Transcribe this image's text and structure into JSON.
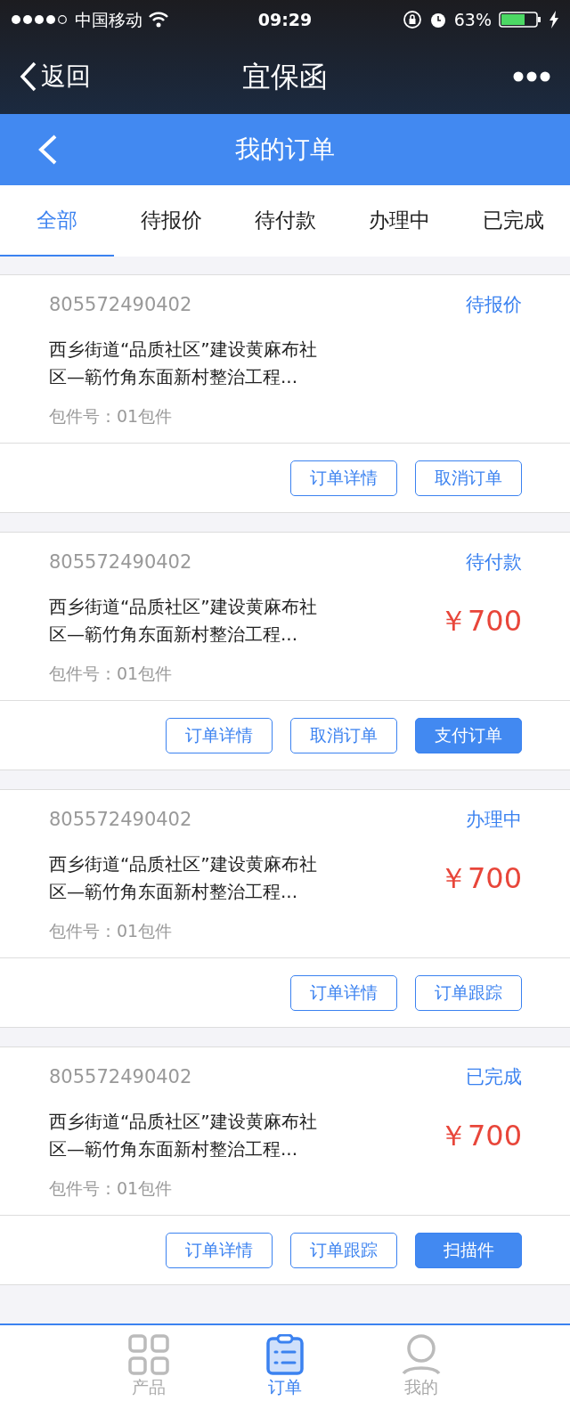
{
  "status_bar": {
    "carrier": "中国移动",
    "time": "09:29",
    "battery": "63%"
  },
  "nav_bar": {
    "back": "返回",
    "title": "宜保函"
  },
  "header": {
    "title": "我的订单"
  },
  "tabs": [
    {
      "label": "全部",
      "selected": true
    },
    {
      "label": "待报价",
      "selected": false
    },
    {
      "label": "待付款",
      "selected": false
    },
    {
      "label": "办理中",
      "selected": false
    },
    {
      "label": "已完成",
      "selected": false
    }
  ],
  "orders": [
    {
      "number": "805572490402",
      "status": "待报价",
      "title_lines": [
        "西乡街道“品质社区”建设黄麻布社",
        "区—簕竹角东面新村整治工程..."
      ],
      "package": "包件号：01包件",
      "buttons": [
        {
          "label": "订单详情",
          "primary": false
        },
        {
          "label": "取消订单",
          "primary": false
        }
      ]
    },
    {
      "number": "805572490402",
      "status": "待付款",
      "title_lines": [
        "西乡街道“品质社区”建设黄麻布社",
        "区—簕竹角东面新村整治工程..."
      ],
      "price": "￥700",
      "package": "包件号：01包件",
      "buttons": [
        {
          "label": "订单详情",
          "primary": false
        },
        {
          "label": "取消订单",
          "primary": false
        },
        {
          "label": "支付订单",
          "primary": true
        }
      ]
    },
    {
      "number": "805572490402",
      "status": "办理中",
      "title_lines": [
        "西乡街道“品质社区”建设黄麻布社",
        "区—簕竹角东面新村整治工程..."
      ],
      "price": "￥700",
      "package": "包件号：01包件",
      "buttons": [
        {
          "label": "订单详情",
          "primary": false
        },
        {
          "label": "订单跟踪",
          "primary": false
        }
      ]
    },
    {
      "number": "805572490402",
      "status": "已完成",
      "title_lines": [
        "西乡街道“品质社区”建设黄麻布社",
        "区—簕竹角东面新村整治工程..."
      ],
      "price": "￥700",
      "package": "包件号：01包件",
      "buttons": [
        {
          "label": "订单详情",
          "primary": false
        },
        {
          "label": "订单跟踪",
          "primary": false
        },
        {
          "label": "扫描件",
          "primary": true
        }
      ]
    }
  ],
  "bottom_nav": [
    {
      "kind": "grid",
      "label": "产品",
      "selected": false
    },
    {
      "kind": "clipboard",
      "label": "订单",
      "selected": true
    },
    {
      "kind": "person",
      "label": "我的",
      "selected": false
    }
  ]
}
